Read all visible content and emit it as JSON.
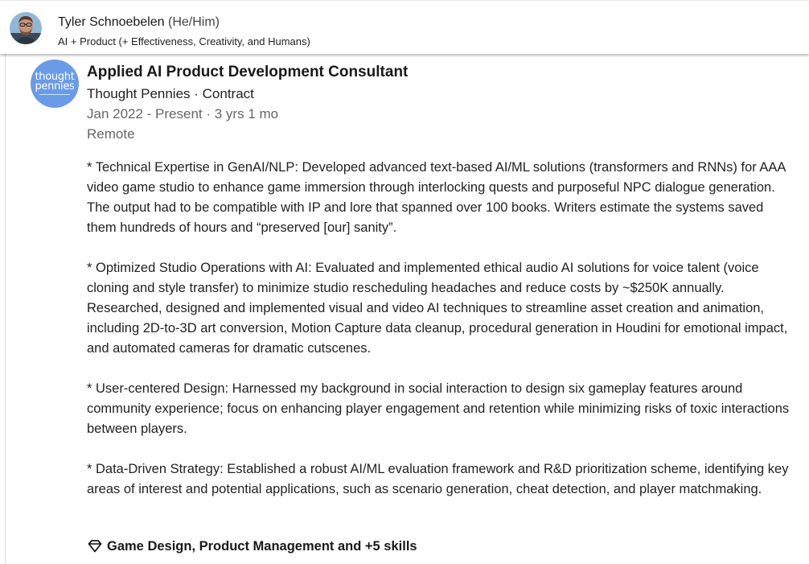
{
  "profile": {
    "name": "Tyler Schnoebelen",
    "pronouns": "(He/Him)",
    "headline": "AI + Product (+ Effectiveness, Creativity, and Humans)"
  },
  "experience": {
    "company_logo_text": [
      "thought",
      "pennies"
    ],
    "title": "Applied AI Product Development Consultant",
    "company_line": "Thought Pennies · Contract",
    "dates": "Jan 2022 - Present · 3 yrs 1 mo",
    "location": "Remote",
    "description": [
      "* Technical Expertise in GenAI/NLP: Developed advanced text-based AI/ML solutions (transformers and RNNs) for AAA video game studio to enhance game immersion through interlocking quests and purposeful NPC dialogue generation. The output had to be compatible with IP and lore that spanned over 100 books. Writers estimate the systems saved them hundreds of hours and “preserved [our] sanity”.",
      "* Optimized Studio Operations with AI: Evaluated and implemented ethical audio AI solutions for voice talent (voice cloning and style transfer) to minimize studio rescheduling headaches and reduce costs by ~$250K annually. Researched, designed and implemented visual and video AI techniques to streamline asset creation and animation, including 2D-to-3D art conversion, Motion Capture data cleanup, procedural generation in Houdini for emotional impact, and automated cameras for dramatic cutscenes.",
      "* User-centered Design: Harnessed my background in social interaction to design six gameplay features around community experience; focus on enhancing player engagement and retention while minimizing risks of toxic interactions between players.",
      "* Data-Driven Strategy: Established a robust AI/ML evaluation framework and R&D prioritization scheme, identifying key areas of interest and potential applications, such as scenario generation, cheat detection, and player matchmaking."
    ],
    "skills_label": "Game Design, Product Management and +5 skills",
    "skills_icon": "diamond-icon"
  },
  "colors": {
    "logo_bg": "#6a9be8",
    "muted_text": "#666666",
    "body_text": "#222222"
  }
}
